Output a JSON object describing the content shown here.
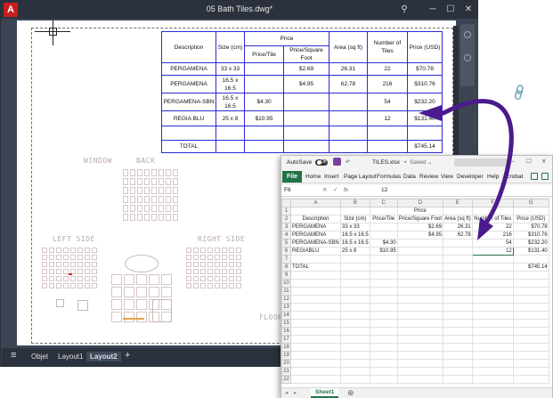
{
  "autocad": {
    "logo": "A",
    "title": "05 Bath Tiles.dwg*",
    "tabs": {
      "objet": "Objet",
      "layout1": "Layout1",
      "layout2": "Layout2",
      "add": "+"
    },
    "table": {
      "headers": {
        "description": "Description",
        "size": "Size (cm)",
        "price": "Price",
        "price_tile": "Price/Tile",
        "price_sqft": "Price/Square Foot",
        "area": "Area (sq ft)",
        "number": "Number of Tiles",
        "price_usd": "Price (USD)"
      },
      "rows": [
        {
          "desc": "PERGAMENA",
          "size": "33 x 33",
          "ptile": "",
          "psqft": "$2.69",
          "area": "26.31",
          "num": "22",
          "usd": "$70.78"
        },
        {
          "desc": "PERGAMENA",
          "size": "16.5 x 16.5",
          "ptile": "",
          "psqft": "$4.95",
          "area": "62.78",
          "num": "216",
          "usd": "$310.76"
        },
        {
          "desc": "PERGAMENA-SBN",
          "size": "16.5 x 16.5",
          "ptile": "$4.30",
          "psqft": "",
          "area": "",
          "num": "54",
          "usd": "$232.20"
        },
        {
          "desc": "REGIA BLU",
          "size": "25 x 8",
          "ptile": "$10.95",
          "psqft": "",
          "area": "",
          "num": "12",
          "usd": "$131.40"
        },
        {
          "desc": "",
          "size": "",
          "ptile": "",
          "psqft": "",
          "area": "",
          "num": "",
          "usd": ""
        },
        {
          "desc": "TOTAL",
          "size": "",
          "ptile": "",
          "psqft": "",
          "area": "",
          "num": "",
          "usd": "$745.14"
        }
      ]
    },
    "plan_labels": {
      "window": "WINDOW",
      "back": "BACK",
      "left_side": "LEFT SIDE",
      "right_side": "RIGHT SIDE",
      "floor": "FLOOR"
    }
  },
  "excel": {
    "autosave": "AutoSave",
    "autosave_state": "Off",
    "filename": "TILES.xlsx",
    "saved": "Saved",
    "ribbon_tabs": [
      "File",
      "Home",
      "Insert",
      "Page Layout",
      "Formulas",
      "Data",
      "Review",
      "View",
      "Developer",
      "Help",
      "Acrobat"
    ],
    "name_box": "F6",
    "fx": "fx",
    "formula_value": "12",
    "columns": [
      "A",
      "B",
      "C",
      "D",
      "E",
      "F",
      "G"
    ],
    "rows": [
      {
        "n": "1",
        "c": [
          "",
          "",
          "",
          "Price",
          "",
          "",
          ""
        ]
      },
      {
        "n": "2",
        "c": [
          "Description",
          "Size (cm)",
          "Price/Tile",
          "Price/Square Foot",
          "Area (sq ft)",
          "Number of Tiles",
          "Price (USD)"
        ]
      },
      {
        "n": "3",
        "c": [
          "PERGAMENA",
          "33 x 33",
          "",
          "$2.69",
          "26.31",
          "22",
          "$70.78"
        ]
      },
      {
        "n": "4",
        "c": [
          "PERGAMENA",
          "16.5 x 16.5",
          "",
          "$4.95",
          "62.78",
          "216",
          "$310.76"
        ]
      },
      {
        "n": "5",
        "c": [
          "PERGAMENA-SBN",
          "16.5 x 16.5",
          "$4.30",
          "",
          "",
          "54",
          "$232.20"
        ]
      },
      {
        "n": "6",
        "c": [
          "REGIABLU",
          "25 x 8",
          "$10.95",
          "",
          "",
          "12",
          "$131.40"
        ]
      },
      {
        "n": "7",
        "c": [
          "",
          "",
          "",
          "",
          "",
          "",
          ""
        ]
      },
      {
        "n": "8",
        "c": [
          "TOTAL",
          "",
          "",
          "",
          "",
          "",
          "$745.14"
        ]
      },
      {
        "n": "9",
        "c": [
          "",
          "",
          "",
          "",
          "",
          "",
          ""
        ]
      },
      {
        "n": "10",
        "c": [
          "",
          "",
          "",
          "",
          "",
          "",
          ""
        ]
      },
      {
        "n": "11",
        "c": [
          "",
          "",
          "",
          "",
          "",
          "",
          ""
        ]
      },
      {
        "n": "12",
        "c": [
          "",
          "",
          "",
          "",
          "",
          "",
          ""
        ]
      },
      {
        "n": "13",
        "c": [
          "",
          "",
          "",
          "",
          "",
          "",
          ""
        ]
      },
      {
        "n": "14",
        "c": [
          "",
          "",
          "",
          "",
          "",
          "",
          ""
        ]
      },
      {
        "n": "15",
        "c": [
          "",
          "",
          "",
          "",
          "",
          "",
          ""
        ]
      },
      {
        "n": "16",
        "c": [
          "",
          "",
          "",
          "",
          "",
          "",
          ""
        ]
      },
      {
        "n": "17",
        "c": [
          "",
          "",
          "",
          "",
          "",
          "",
          ""
        ]
      },
      {
        "n": "18",
        "c": [
          "",
          "",
          "",
          "",
          "",
          "",
          ""
        ]
      },
      {
        "n": "19",
        "c": [
          "",
          "",
          "",
          "",
          "",
          "",
          ""
        ]
      },
      {
        "n": "20",
        "c": [
          "",
          "",
          "",
          "",
          "",
          "",
          ""
        ]
      },
      {
        "n": "21",
        "c": [
          "",
          "",
          "",
          "",
          "",
          "",
          ""
        ]
      },
      {
        "n": "22",
        "c": [
          "",
          "",
          "",
          "",
          "",
          "",
          ""
        ]
      }
    ],
    "sheet_tab": "Sheet1",
    "accent": "#217346"
  },
  "colors": {
    "table_border": "#2b2bd6",
    "arrow": "#4b1a8c",
    "acad_chrome": "#2b323d"
  }
}
